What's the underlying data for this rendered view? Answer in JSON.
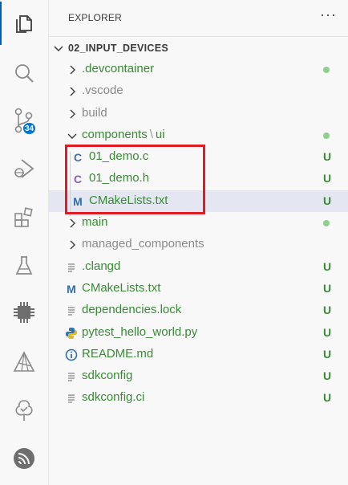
{
  "activity_bar": {
    "items": [
      {
        "name": "explorer-icon"
      },
      {
        "name": "search-icon"
      },
      {
        "name": "source-control-icon",
        "badge": "34"
      },
      {
        "name": "run-debug-icon"
      },
      {
        "name": "extensions-icon"
      },
      {
        "name": "testing-icon"
      },
      {
        "name": "chip-icon"
      },
      {
        "name": "idf-icon"
      },
      {
        "name": "tree-icon"
      },
      {
        "name": "espressif-icon"
      }
    ]
  },
  "sidebar": {
    "title": "EXPLORER",
    "more": "···",
    "section_title": "02_INPUT_DEVICES"
  },
  "tree": {
    "devcontainer": {
      "label": ".devcontainer",
      "status": "dot"
    },
    "vscode": {
      "label": ".vscode"
    },
    "build": {
      "label": "build"
    },
    "components": {
      "label": "components",
      "sub": "ui",
      "status": "dot"
    },
    "demo_c": {
      "label": "01_demo.c",
      "status": "U"
    },
    "demo_h": {
      "label": "01_demo.h",
      "status": "U"
    },
    "cmake_ui": {
      "label": "CMakeLists.txt",
      "status": "U"
    },
    "main": {
      "label": "main",
      "status": "dot"
    },
    "managed": {
      "label": "managed_components"
    },
    "clangd": {
      "label": ".clangd",
      "status": "U"
    },
    "cmake_root": {
      "label": "CMakeLists.txt",
      "status": "U"
    },
    "deps": {
      "label": "dependencies.lock",
      "status": "U"
    },
    "pytest": {
      "label": "pytest_hello_world.py",
      "status": "U"
    },
    "readme": {
      "label": "README.md",
      "status": "U"
    },
    "sdkconfig": {
      "label": "sdkconfig",
      "status": "U"
    },
    "sdkconfig_ci": {
      "label": "sdkconfig.ci",
      "status": "U"
    }
  },
  "colors": {
    "untracked_green": "#388a34",
    "highlight_red": "#e01b24",
    "badge_blue": "#0078d4",
    "c_icon": "#4a6fa5",
    "h_icon": "#8e5bb5",
    "cmake_icon": "#2f6fa8"
  }
}
